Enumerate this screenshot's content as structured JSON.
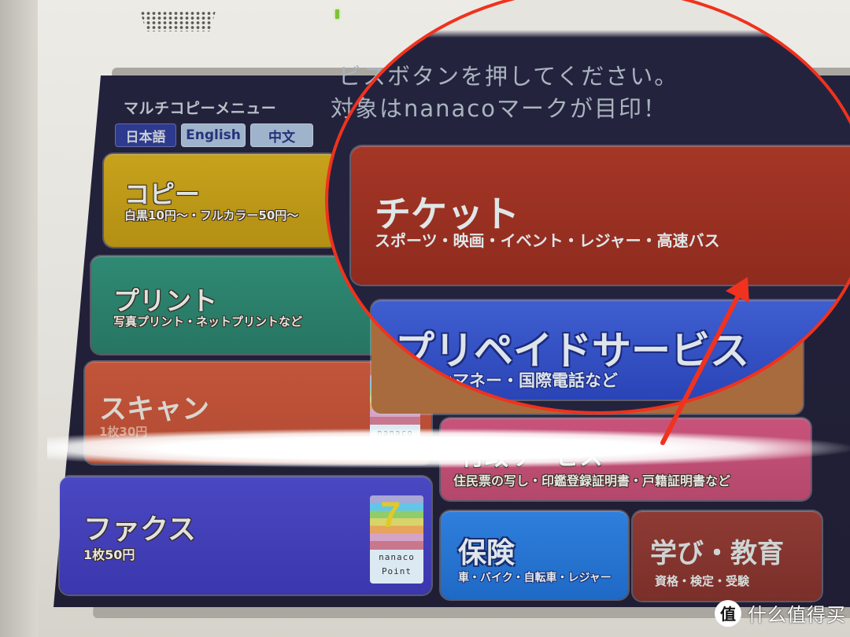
{
  "screen": {
    "title": "マルチコピーメニュー",
    "instructions": {
      "line1": "ビスボタンを押してください。",
      "line2": "対象はnanacoマークが目印！"
    },
    "languages": [
      {
        "label": "日本語",
        "active": true
      },
      {
        "label": "English",
        "active": false
      },
      {
        "label": "中文",
        "active": false
      }
    ],
    "services": {
      "copy": {
        "title": "コピー",
        "subtitle": "白黒10円～・フルカラー50円～"
      },
      "print": {
        "title": "プリント",
        "subtitle": "写真プリント・ネットプリントなど"
      },
      "scan": {
        "title": "スキャン",
        "subtitle": "1枚30円",
        "badge": "nanaco"
      },
      "fax": {
        "title": "ファクス",
        "subtitle": "1枚50円",
        "badge_line1": "nanaco",
        "badge_line2": "Point"
      },
      "ticket": {
        "title": "チケット",
        "subtitle": "スポーツ・映画・イベント・レジャー・高速バス"
      },
      "prepaid": {
        "title": "プリペイドサービス",
        "subtitle": "コインマネー・国際電話など"
      },
      "government": {
        "title": "行政サービス",
        "subtitle": "住民票の写し・印鑑登録証明書・戸籍証明書など"
      },
      "insurance": {
        "title": "保険",
        "subtitle": "車・バイク・自転車・レジャー"
      },
      "learning": {
        "title": "学び・教育",
        "subtitle": "資格・検定・受験"
      }
    }
  },
  "annotation": {
    "color": "#f0321e",
    "shape": "circle-and-arrow",
    "target": "ticket"
  },
  "watermark": {
    "logo_char": "值",
    "text": "什么值得买"
  }
}
